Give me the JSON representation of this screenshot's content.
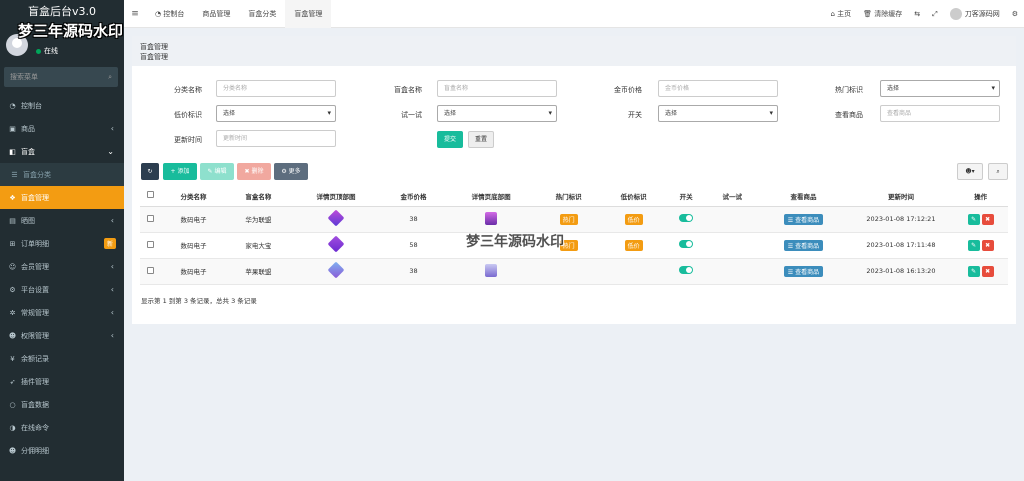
{
  "brand": "盲盒后台v3.0",
  "watermark": "梦三年源码水印",
  "user": {
    "status": "在线"
  },
  "sidebar": {
    "search_placeholder": "搜索菜单",
    "items": [
      {
        "label": "控制台",
        "icon": "dashboard-icon"
      },
      {
        "label": "商品",
        "icon": "cube-icon"
      },
      {
        "label": "盲盒",
        "icon": "folder-icon"
      },
      {
        "label": "盲盒分类",
        "icon": "list-icon"
      },
      {
        "label": "盲盒管理",
        "icon": "cubes-icon"
      },
      {
        "label": "晒图",
        "icon": "image-icon"
      },
      {
        "label": "订单明细",
        "icon": "cart-icon",
        "badge": "新"
      },
      {
        "label": "会员管理",
        "icon": "users-icon"
      },
      {
        "label": "平台设置",
        "icon": "gear-icon"
      },
      {
        "label": "常规管理",
        "icon": "cog-icon"
      },
      {
        "label": "权限管理",
        "icon": "group-icon"
      },
      {
        "label": "余额记录",
        "icon": "yen-icon"
      },
      {
        "label": "插件管理",
        "icon": "rocket-icon"
      },
      {
        "label": "盲盒数据",
        "icon": "circle-icon"
      },
      {
        "label": "在线命令",
        "icon": "terminal-icon"
      },
      {
        "label": "分佣明细",
        "icon": "users-icon"
      }
    ]
  },
  "topbar": {
    "tabs": [
      "控制台",
      "商品管理",
      "盲盒分类",
      "盲盒管理"
    ],
    "home": "主页",
    "clear_cache": "清除缓存",
    "username": "刀客源码网"
  },
  "breadcrumb": {
    "title": "盲盒管理",
    "sub": "盲盒管理"
  },
  "filters": {
    "category_label": "分类名称",
    "category_ph": "分类名称",
    "name_label": "盲盒名称",
    "name_ph": "盲盒名称",
    "price_label": "金币价格",
    "price_ph": "金币价格",
    "hot_label": "热门标识",
    "hot_value": "选择",
    "low_label": "低价标识",
    "low_value": "选择",
    "try_label": "试一试",
    "try_value": "选择",
    "switch_label": "开关",
    "switch_value": "选择",
    "view_label": "查看商品",
    "view_ph": "查看商品",
    "update_label": "更新时间",
    "update_ph": "更新时间",
    "submit": "提交",
    "reset": "重置"
  },
  "toolbar": {
    "add": "添加",
    "edit": "编辑",
    "delete": "删除",
    "more": "更多"
  },
  "table": {
    "headers": [
      "分类名称",
      "盲盒名称",
      "详情页顶部图",
      "金币价格",
      "详情页底部图",
      "热门标识",
      "低价标识",
      "开关",
      "试一试",
      "查看商品",
      "更新时间",
      "操作"
    ],
    "rows": [
      {
        "category": "数码电子",
        "name": "华为联盟",
        "price": "38",
        "hot": "热门",
        "low": "低价",
        "view": "查看商品",
        "time": "2023-01-08 17:12:21"
      },
      {
        "category": "数码电子",
        "name": "家电大宝",
        "price": "58",
        "hot": "热门",
        "low": "低价",
        "view": "查看商品",
        "time": "2023-01-08 17:11:48"
      },
      {
        "category": "数码电子",
        "name": "苹果联盟",
        "price": "38",
        "hot": "",
        "low": "",
        "view": "查看商品",
        "time": "2023-01-08 16:13:20"
      }
    ]
  },
  "footer": "显示第 1 到第 3 条记录，总共 3 条记录",
  "colors": {
    "sidebar": "#222d32",
    "accent": "#f39c12",
    "green": "#18bc9c",
    "blue": "#3c8dbc",
    "red": "#e74c3c"
  }
}
